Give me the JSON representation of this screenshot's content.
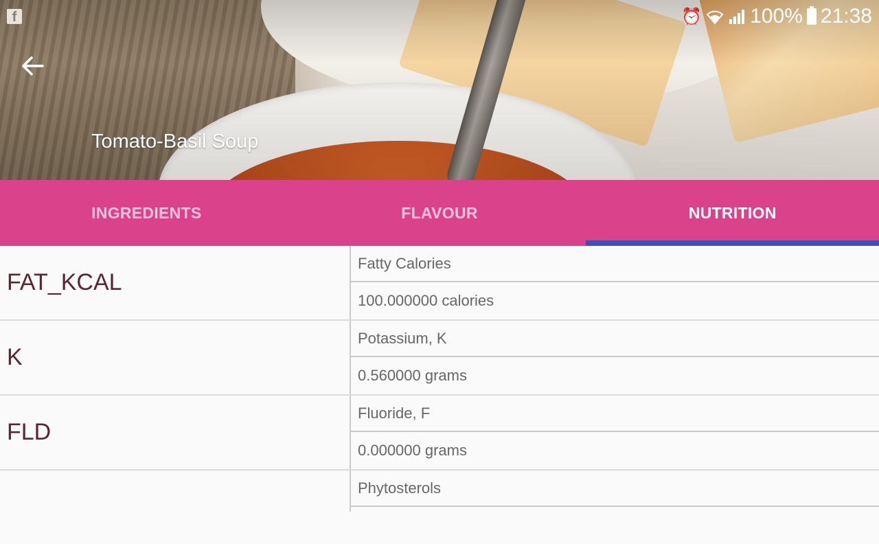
{
  "status": {
    "battery": "100%",
    "time": "21:38",
    "icons": [
      "facebook-icon",
      "alarm-icon",
      "wifi-icon",
      "signal-icon",
      "battery-icon"
    ]
  },
  "header": {
    "title": "Tomato-Basil Soup",
    "back_icon": "arrow-left-icon"
  },
  "tabs": [
    {
      "label": "INGREDIENTS",
      "active": false
    },
    {
      "label": "FLAVOUR",
      "active": false
    },
    {
      "label": "NUTRITION",
      "active": true
    }
  ],
  "nutrients": [
    {
      "code": "FAT_KCAL",
      "name": "Fatty Calories",
      "value": "100.000000 calories"
    },
    {
      "code": "K",
      "name": "Potassium, K",
      "value": "0.560000 grams"
    },
    {
      "code": "FLD",
      "name": "Fluoride, F",
      "value": "0.000000 grams"
    },
    {
      "code": "",
      "name": "Phytosterols",
      "value": ""
    }
  ],
  "colors": {
    "tab_bar": "#da428b",
    "tab_indicator": "#3f51b5",
    "code_text": "#5a2432"
  }
}
